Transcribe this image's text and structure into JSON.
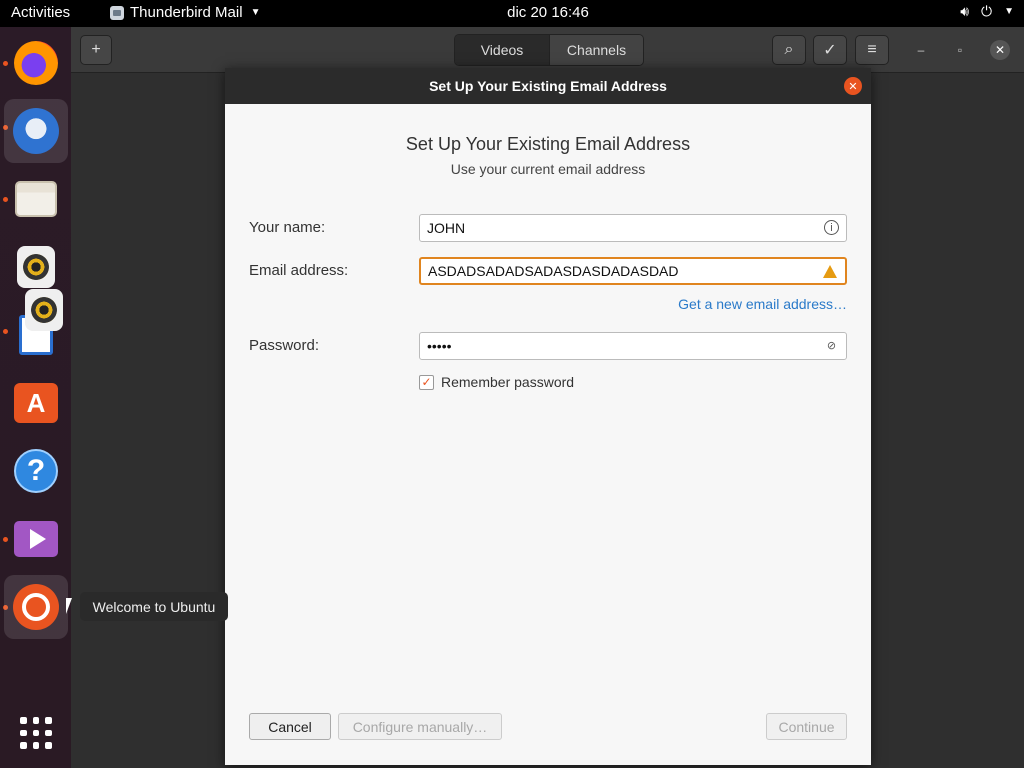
{
  "topbar": {
    "activities": "Activities",
    "app_name": "Thunderbird Mail",
    "clock": "dic 20  16:46",
    "sys_icons": [
      "volume-icon",
      "power-icon",
      "caret-down-icon"
    ]
  },
  "dock": {
    "items": [
      {
        "name": "firefox",
        "icon": "firefox-icon"
      },
      {
        "name": "thunderbird",
        "icon": "thunderbird-icon"
      },
      {
        "name": "files",
        "icon": "files-icon"
      },
      {
        "name": "rhythmbox",
        "icon": "speaker-icon"
      },
      {
        "name": "writer",
        "icon": "writer-icon"
      },
      {
        "name": "software",
        "icon": "store-icon"
      },
      {
        "name": "help",
        "icon": "help-icon"
      },
      {
        "name": "videos",
        "icon": "video-icon"
      },
      {
        "name": "ubuntu",
        "icon": "ubuntu-icon"
      }
    ],
    "tooltip": "Welcome to Ubuntu"
  },
  "bg_window": {
    "tabs": [
      "Videos",
      "Channels"
    ],
    "new_label": "+",
    "search_icon": "⌕",
    "check_icon": "✓",
    "menu_icon": "≡",
    "min_icon": "–",
    "max_icon": "▫",
    "close_icon": "✕"
  },
  "dialog": {
    "title": "Set Up Your Existing Email Address",
    "heading": "Set Up Your Existing Email Address",
    "subheading": "Use your current email address",
    "name_label": "Your name:",
    "name_value": "JOHN",
    "email_label": "Email address:",
    "email_value": "ASDADSADADSADASDASDADASDAD",
    "new_email_link": "Get a new email address…",
    "password_label": "Password:",
    "password_value": "•••••",
    "remember_label": "Remember password",
    "remember_checked": true,
    "cancel_label": "Cancel",
    "configure_label": "Configure manually…",
    "continue_label": "Continue"
  }
}
